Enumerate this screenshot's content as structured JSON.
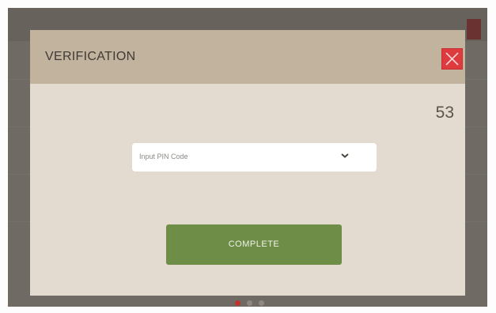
{
  "modal": {
    "title": "VERIFICATION",
    "counter": "53",
    "pin_select": {
      "placeholder": "Input PIN Code"
    },
    "complete_label": "COMPLETE"
  },
  "icons": {
    "close": "close-icon",
    "chevron": "chevron-down-icon"
  },
  "pagination": {
    "active_index": 0,
    "count": 3
  },
  "colors": {
    "header": "#c2b39f",
    "body": "#e4dbd0",
    "close": "#de3b3f",
    "complete": "#6e8e47",
    "active_dot": "#c1342c"
  }
}
